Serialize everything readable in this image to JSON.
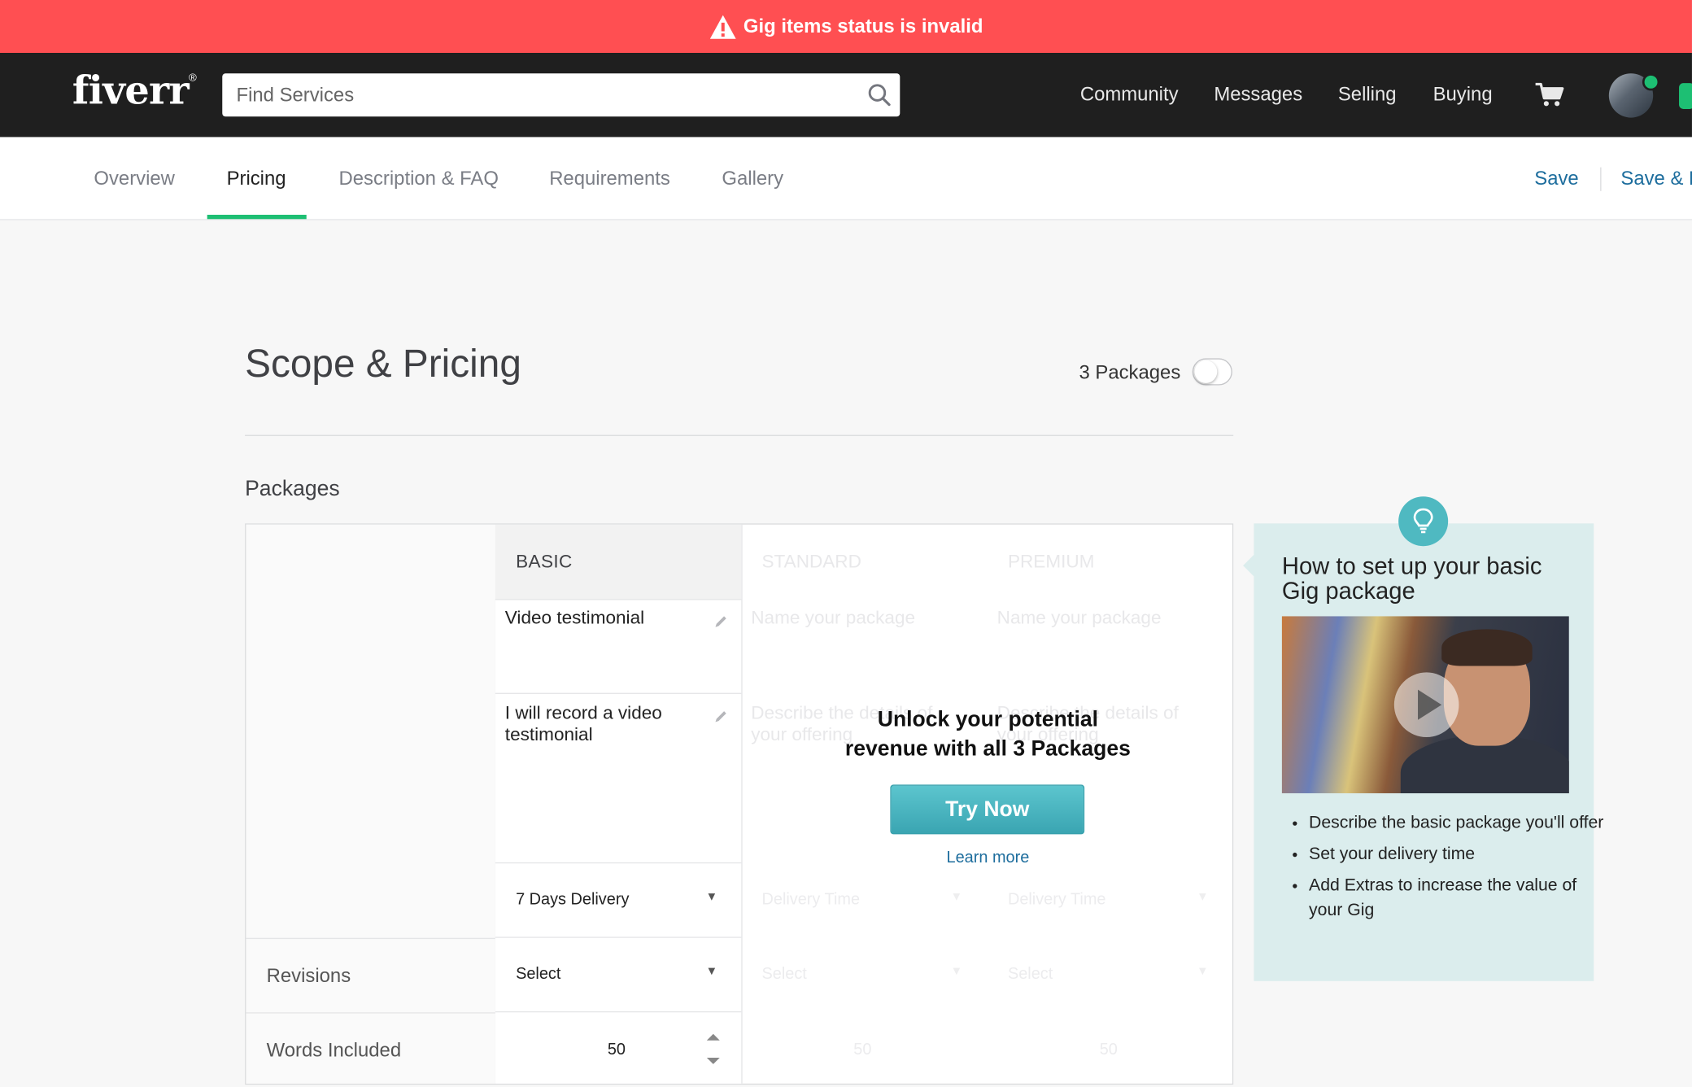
{
  "alert": {
    "text": "Gig items status is invalid"
  },
  "header": {
    "logo": "fiverr",
    "logo_mark": "®",
    "search_placeholder": "Find Services",
    "nav": [
      "Community",
      "Messages",
      "Selling",
      "Buying"
    ]
  },
  "tabs": {
    "items": [
      "Overview",
      "Pricing",
      "Description & FAQ",
      "Requirements",
      "Gallery"
    ],
    "active": "Pricing",
    "save": "Save",
    "save_preview": "Save & P"
  },
  "page": {
    "title": "Scope & Pricing",
    "packages_toggle_label": "3 Packages",
    "packages_toggle_on": false,
    "section_title": "Packages"
  },
  "table": {
    "columns": [
      "BASIC",
      "STANDARD",
      "PREMIUM"
    ],
    "basic": {
      "name": "Video testimonial",
      "description": "I will record a video testimonial",
      "delivery": "7 Days Delivery",
      "revisions": "Select",
      "words": "50"
    },
    "placeholders": {
      "name": "Name your package",
      "description": "Describe the details of your offering",
      "delivery": "Delivery Time",
      "revisions": "Select",
      "words": "50"
    },
    "row_labels": {
      "revisions": "Revisions",
      "words": "Words Included"
    },
    "upsell": {
      "title_line1": "Unlock your potential",
      "title_line2": "revenue with all 3 Packages",
      "button": "Try Now",
      "link": "Learn more"
    }
  },
  "help": {
    "title": "How to set up your basic Gig package",
    "bullets": [
      "Describe the basic package you'll offer",
      "Set your delivery time",
      "Add Extras to increase the value of your Gig"
    ]
  },
  "colors": {
    "alert": "#ff4f52",
    "topbar": "#1f1f1f",
    "accent_green": "#1dbf73",
    "link_blue": "#1d6d9d",
    "try_button": "#4fb9c1",
    "help_bg": "#dbeded"
  }
}
